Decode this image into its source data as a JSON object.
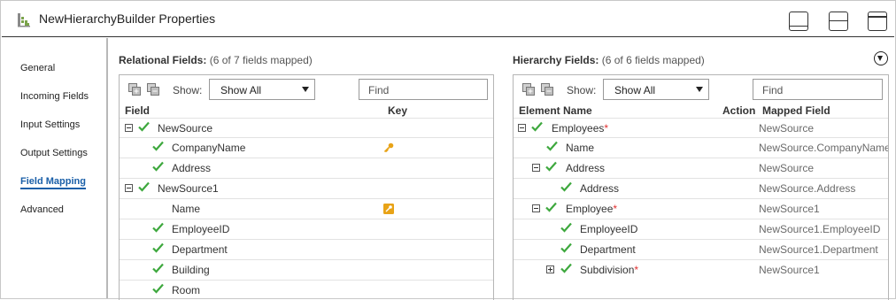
{
  "window": {
    "title": "NewHierarchyBuilder Properties",
    "icons": [
      "hierarchy-builder-icon",
      "layout-bottom-panel-icon",
      "layout-split-horizontal-icon",
      "layout-top-panel-icon"
    ]
  },
  "sidebar": {
    "items": [
      {
        "label": "General",
        "active": false
      },
      {
        "label": "Incoming Fields",
        "active": false
      },
      {
        "label": "Input Settings",
        "active": false
      },
      {
        "label": "Output Settings",
        "active": false
      },
      {
        "label": "Field Mapping",
        "active": true
      },
      {
        "label": "Advanced",
        "active": false
      }
    ]
  },
  "relational": {
    "title": "Relational Fields:",
    "subtitle": "(6 of 7 fields mapped)",
    "show_label": "Show:",
    "show_value": "Show All",
    "find_placeholder": "Find",
    "col_field": "Field",
    "col_key": "Key",
    "rows": [
      {
        "name": "NewSource",
        "group": true,
        "checked": true
      },
      {
        "name": "CompanyName",
        "checked": true,
        "key": "key"
      },
      {
        "name": "Address",
        "checked": true
      },
      {
        "name": "NewSource1",
        "group": true,
        "checked": true
      },
      {
        "name": "Name",
        "checked": false,
        "key": "key-box"
      },
      {
        "name": "EmployeeID",
        "checked": true
      },
      {
        "name": "Department",
        "checked": true
      },
      {
        "name": "Building",
        "checked": true
      },
      {
        "name": "Room",
        "checked": true
      }
    ]
  },
  "hierarchy": {
    "title": "Hierarchy Fields:",
    "subtitle": "(6 of 6 fields mapped)",
    "show_label": "Show:",
    "show_value": "Show All",
    "find_placeholder": "Find",
    "col_element": "Element Name",
    "col_action": "Action",
    "col_mapped": "Mapped Field",
    "required_marker": "*",
    "rows": [
      {
        "name": "Employees",
        "required": true,
        "mapped": "NewSource"
      },
      {
        "name": "Name",
        "required": false,
        "mapped": "NewSource.CompanyName"
      },
      {
        "name": "Address",
        "required": false,
        "mapped": "NewSource"
      },
      {
        "name": "Address",
        "required": false,
        "mapped": "NewSource.Address"
      },
      {
        "name": "Employee",
        "required": true,
        "mapped": "NewSource1"
      },
      {
        "name": "EmployeeID",
        "required": false,
        "mapped": "NewSource1.EmployeeID"
      },
      {
        "name": "Department",
        "required": false,
        "mapped": "NewSource1.Department"
      },
      {
        "name": "Subdivision",
        "required": true,
        "mapped": "NewSource1"
      }
    ]
  },
  "colors": {
    "accent": "#1a5fa8",
    "check": "#3ea83e",
    "required": "#e03030",
    "key": "#e8a317"
  }
}
